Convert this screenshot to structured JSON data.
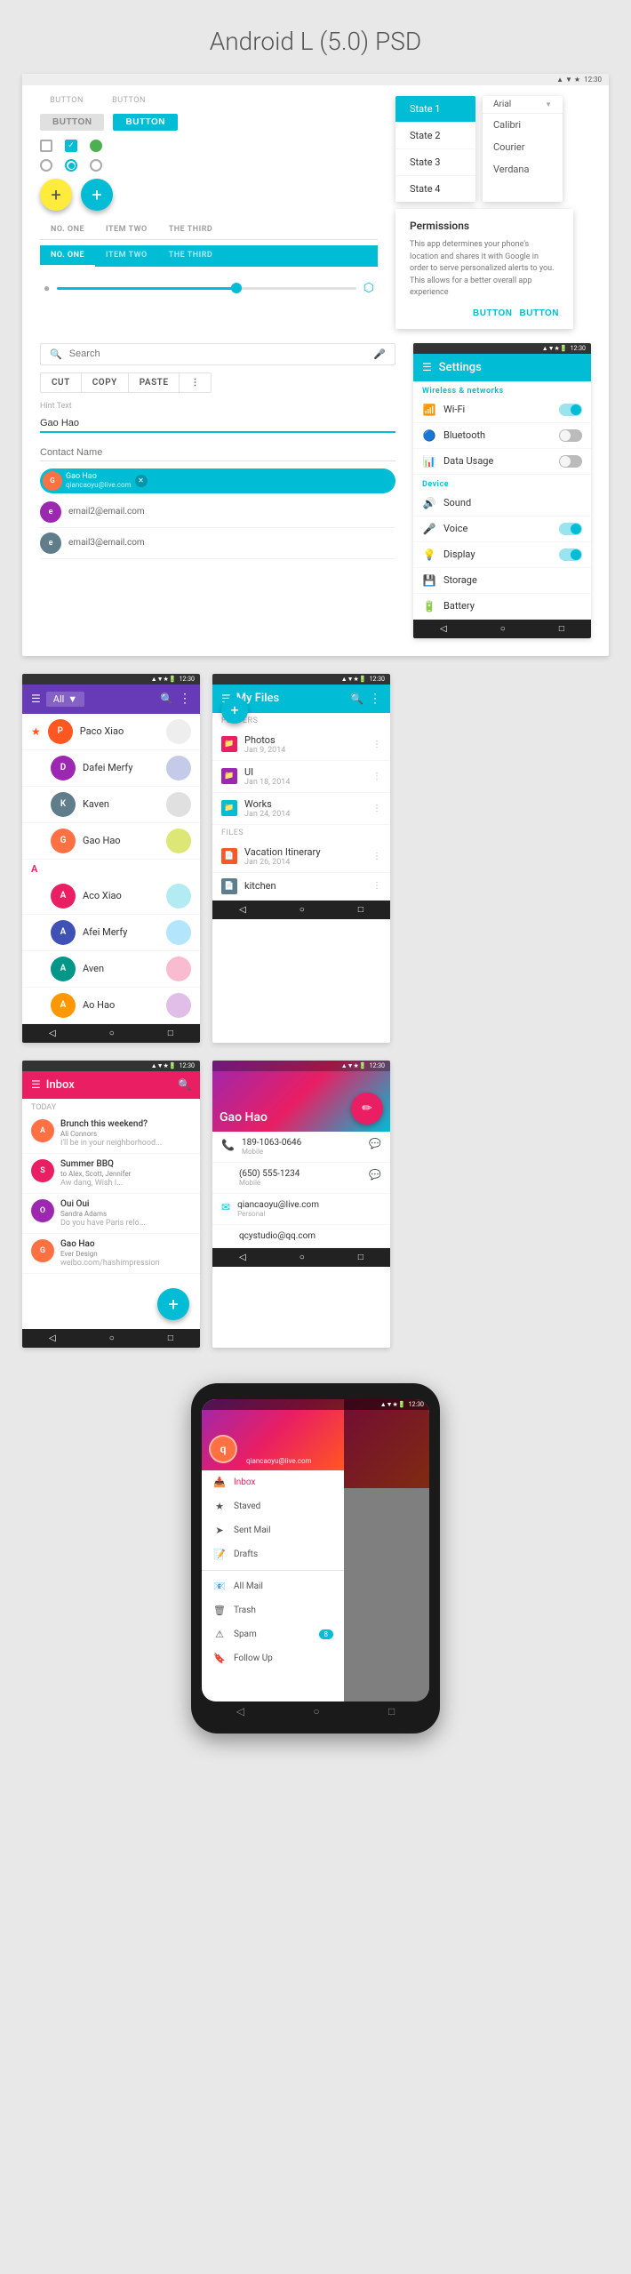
{
  "page": {
    "title": "Android L (5.0) PSD"
  },
  "buttons": {
    "btn1": "BUTTON",
    "btn2": "BUTTON",
    "cut": "CUT",
    "copy": "COPY",
    "paste": "PASTE"
  },
  "tabs": {
    "items": [
      "NO. ONE",
      "ITEM TWO",
      "THE THIRD"
    ]
  },
  "states": {
    "items": [
      "State 1",
      "State 2",
      "State 3",
      "State 4"
    ],
    "selected": "State 1"
  },
  "fonts": {
    "items": [
      "Arial",
      "Calibri",
      "Courier",
      "Verdana"
    ]
  },
  "permissions": {
    "title": "Permissions",
    "text": "This app determines your phone's location and shares it with Google in order to serve personalized alerts to you. This allows for a better overall app experience",
    "btn1": "BUTTON",
    "btn2": "BUTTON"
  },
  "search": {
    "placeholder": "Search"
  },
  "textfields": {
    "hint": "Hint Text",
    "value": "Gao Hao"
  },
  "contact_input": {
    "placeholder": "Contact Name"
  },
  "chip": {
    "name": "Gao Hao",
    "email": "qiancaoyu@live.com"
  },
  "email_list": {
    "items": [
      "email2@email.com",
      "email3@email.com"
    ]
  },
  "settings": {
    "title": "Settings",
    "wireless_section": "Wireless & networks",
    "device_section": "Device",
    "items": [
      {
        "icon": "wifi",
        "label": "Wi-Fi",
        "toggle": "on"
      },
      {
        "icon": "bt",
        "label": "Bluetooth",
        "toggle": "off"
      },
      {
        "icon": "data",
        "label": "Data Usage",
        "toggle": "off"
      },
      {
        "icon": "sound",
        "label": "Sound",
        "toggle": "none"
      },
      {
        "icon": "voice",
        "label": "Voice",
        "toggle": "on"
      },
      {
        "icon": "display",
        "label": "Display",
        "toggle": "on"
      },
      {
        "icon": "storage",
        "label": "Storage",
        "toggle": "none"
      },
      {
        "icon": "battery",
        "label": "Battery",
        "toggle": "none"
      }
    ]
  },
  "contacts": {
    "filter": "All",
    "items": [
      {
        "name": "Paco Xiao",
        "initial": "P",
        "color": "#ff5722",
        "starred": true
      },
      {
        "name": "Dafei Merfy",
        "initial": "D",
        "color": "#9c27b0",
        "starred": false
      },
      {
        "name": "Kaven",
        "initial": "K",
        "color": "#607d8b",
        "starred": false
      },
      {
        "name": "Gao Hao",
        "initial": "G",
        "color": "#ff7043",
        "starred": false
      },
      {
        "name": "Aco Xiao",
        "initial": "A",
        "color": "#e91e63",
        "starred": false
      },
      {
        "name": "Afei Merfy",
        "initial": "A",
        "color": "#3f51b5",
        "starred": false
      },
      {
        "name": "Aven",
        "initial": "A",
        "color": "#009688",
        "starred": false
      },
      {
        "name": "Ao Hao",
        "initial": "A",
        "color": "#ff9800",
        "starred": false
      }
    ]
  },
  "files": {
    "title": "My Files",
    "folders_label": "Folders",
    "files_label": "Files",
    "folders": [
      {
        "name": "Photos",
        "date": "Jan 9, 2014",
        "color": "#e91e63"
      },
      {
        "name": "UI",
        "date": "Jan 18, 2014",
        "color": "#9c27b0"
      },
      {
        "name": "Works",
        "date": "Jan 24, 2014",
        "color": "#00bcd4"
      },
      {
        "name": "Vacation Itinerary",
        "date": "Jan 26, 2014",
        "color": "#ff5722"
      },
      {
        "name": "kitchen",
        "date": "",
        "color": "#607d8b"
      }
    ]
  },
  "inbox": {
    "title": "Inbox",
    "date_label": "Today",
    "items": [
      {
        "subject": "Brunch this weekend?",
        "sender": "Ali Connors",
        "preview": "I'll be in your neighborhood..."
      },
      {
        "subject": "Summer BBQ",
        "sender": "to Alex, Scott, Jennifer",
        "preview": "Aw dang, Wish I..."
      },
      {
        "subject": "Oui Oui",
        "sender": "Sandra Adams",
        "preview": "Do you have Paris relo..."
      },
      {
        "subject": "Gao Hao",
        "sender": "Ever Design",
        "preview": "weibo.com/hashimpression"
      }
    ]
  },
  "contact_detail": {
    "name": "Gao Hao",
    "phones": [
      {
        "number": "189-1063-0646",
        "type": "Mobile"
      },
      {
        "number": "(650) 555-1234",
        "type": "Mobile"
      }
    ],
    "emails": [
      {
        "address": "qiancaoyu@live.com",
        "type": "Personal"
      },
      {
        "address": "qcystudio@qq.com",
        "type": ""
      }
    ]
  },
  "drawer": {
    "email": "qiancaoyu@live.com",
    "items": [
      {
        "icon": "inbox",
        "label": "Inbox",
        "badge": ""
      },
      {
        "icon": "star",
        "label": "Staved",
        "badge": ""
      },
      {
        "icon": "send",
        "label": "Sent Mail",
        "badge": ""
      },
      {
        "icon": "draft",
        "label": "Drafts",
        "badge": ""
      },
      {
        "icon": "mail",
        "label": "All Mail",
        "badge": ""
      },
      {
        "icon": "trash",
        "label": "Trash",
        "badge": ""
      },
      {
        "icon": "spam",
        "label": "Spam",
        "badge": "8"
      },
      {
        "icon": "followup",
        "label": "Follow Up",
        "badge": ""
      }
    ]
  },
  "status_bar": {
    "time": "12:30",
    "icons": "▲ ▼ ★ 🔋"
  }
}
